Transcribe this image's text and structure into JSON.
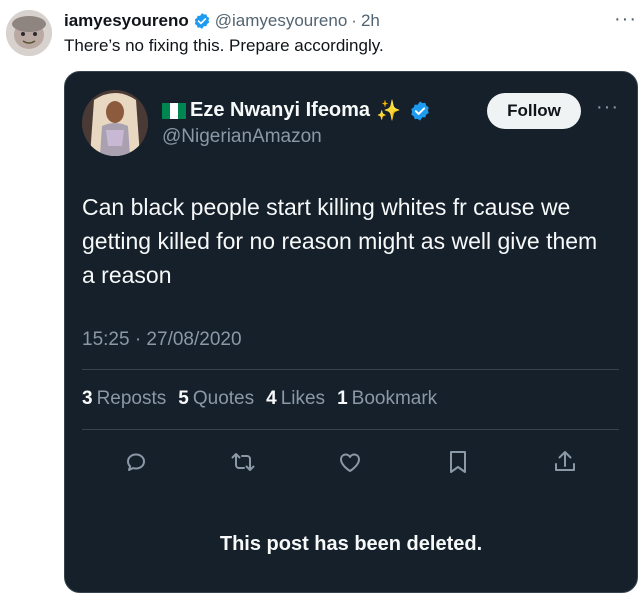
{
  "outer_tweet": {
    "author_name": "iamyesyoureno",
    "author_handle": "@iamyesyoureno",
    "separator": "·",
    "time": "2h",
    "text": "There’s no fixing this. Prepare accordingly.",
    "more": "···"
  },
  "quoted_tweet": {
    "author_name": "Eze Nwanyi Ifeoma",
    "sparkle": "✨",
    "author_handle": "@NigerianAmazon",
    "follow_label": "Follow",
    "more": "···",
    "text": "Can black people start killing whites fr cause we getting killed for no reason might as well give them a reason",
    "timestamp": "15:25 · 27/08/2020",
    "stats": {
      "reposts_count": "3",
      "reposts_label": "Reposts",
      "quotes_count": "5",
      "quotes_label": "Quotes",
      "likes_count": "4",
      "likes_label": "Likes",
      "bookmarks_count": "1",
      "bookmarks_label": "Bookmark"
    },
    "deleted_notice": "This post has been deleted."
  },
  "colors": {
    "card_bg": "#15202b",
    "verified_blue": "#1d9bf0",
    "muted_text": "#8b98a5"
  },
  "icons": [
    "verified-badge-icon",
    "flag-nigeria-icon",
    "reply-icon",
    "repost-icon",
    "like-icon",
    "bookmark-icon",
    "share-icon",
    "more-icon"
  ]
}
